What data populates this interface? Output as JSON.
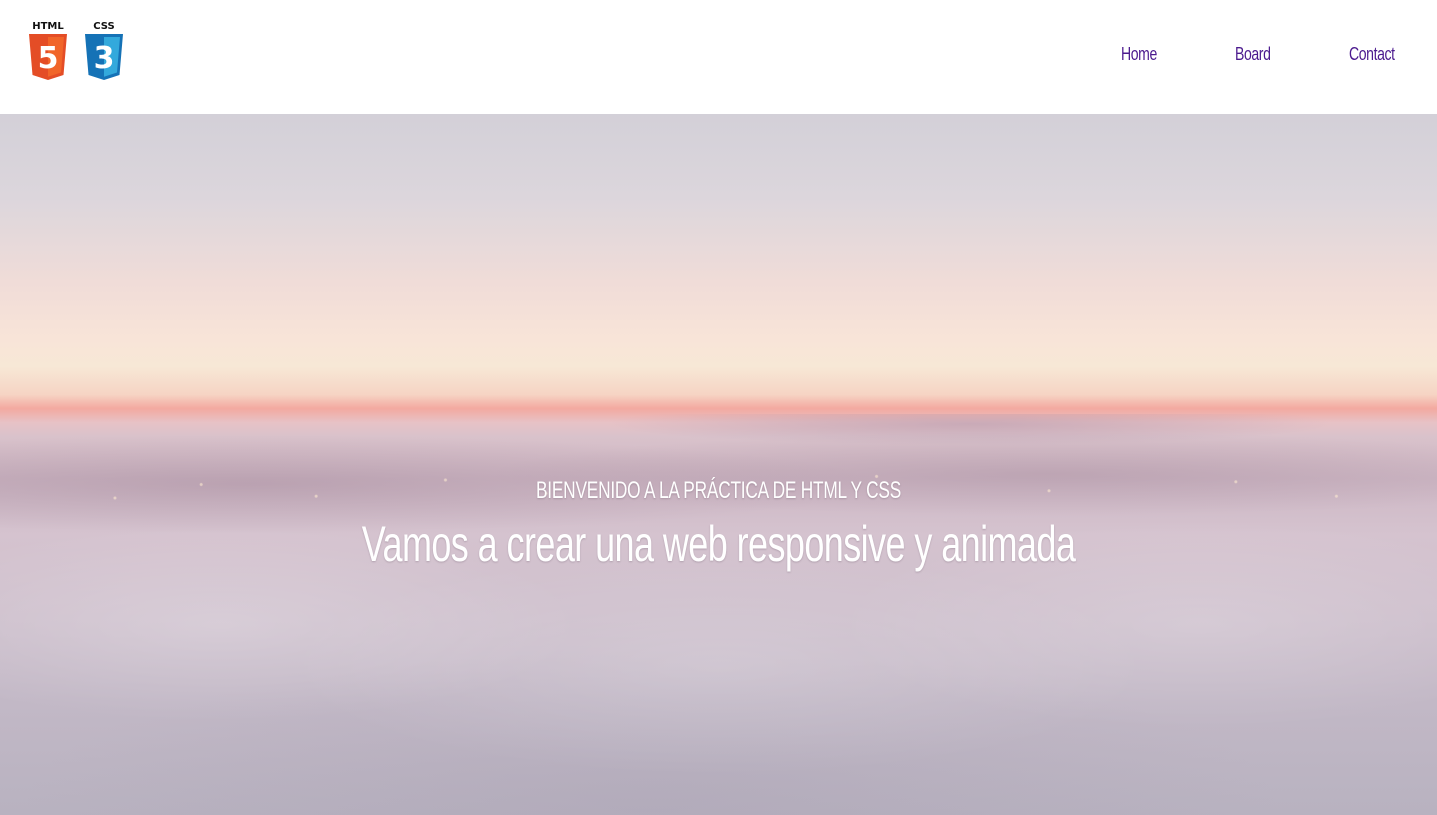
{
  "brand": {
    "badges": [
      {
        "label": "HTML",
        "number": "5",
        "color": "#e44d26",
        "shade": "#f16529"
      },
      {
        "label": "CSS",
        "number": "3",
        "color": "#1572b6",
        "shade": "#33a9dc"
      }
    ]
  },
  "nav": {
    "items": [
      {
        "label": "Home"
      },
      {
        "label": "Board"
      },
      {
        "label": "Contact"
      }
    ],
    "color": "#4b1a8e"
  },
  "hero": {
    "subtitle": "BIENVENIDO A LA PRÁCTICA DE HTML Y CSS",
    "title": "Vamos a crear una web responsive y animada"
  }
}
